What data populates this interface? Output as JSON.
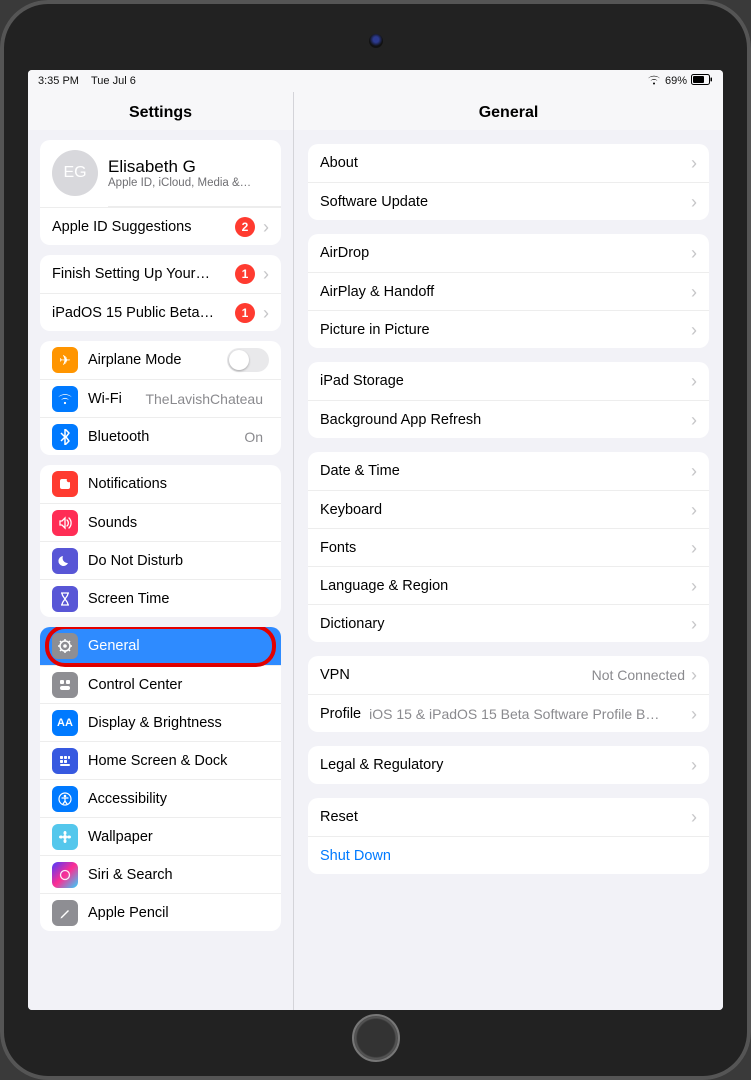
{
  "status": {
    "time": "3:35 PM",
    "date": "Tue Jul 6",
    "battery": "69%"
  },
  "sidebar": {
    "title": "Settings",
    "profile": {
      "initials": "EG",
      "name": "Elisabeth G",
      "subtitle": "Apple ID, iCloud, Media &…"
    },
    "appleIdSuggestions": {
      "label": "Apple ID Suggestions",
      "badge": "2"
    },
    "finishSetup": {
      "label": "Finish Setting Up Your…",
      "badge": "1"
    },
    "betaUpdate": {
      "label": "iPadOS 15 Public Beta…",
      "badge": "1"
    },
    "airplane": {
      "label": "Airplane Mode"
    },
    "wifi": {
      "label": "Wi-Fi",
      "value": "TheLavishChateau"
    },
    "bluetooth": {
      "label": "Bluetooth",
      "value": "On"
    },
    "notifications": {
      "label": "Notifications"
    },
    "sounds": {
      "label": "Sounds"
    },
    "dnd": {
      "label": "Do Not Disturb"
    },
    "screentime": {
      "label": "Screen Time"
    },
    "general": {
      "label": "General"
    },
    "controlCenter": {
      "label": "Control Center"
    },
    "display": {
      "label": "Display & Brightness"
    },
    "homescreen": {
      "label": "Home Screen & Dock"
    },
    "accessibility": {
      "label": "Accessibility"
    },
    "wallpaper": {
      "label": "Wallpaper"
    },
    "siri": {
      "label": "Siri & Search"
    },
    "pencil": {
      "label": "Apple Pencil"
    }
  },
  "detail": {
    "title": "General",
    "about": "About",
    "softwareUpdate": "Software Update",
    "airdrop": "AirDrop",
    "airplay": "AirPlay & Handoff",
    "pip": "Picture in Picture",
    "storage": "iPad Storage",
    "bgRefresh": "Background App Refresh",
    "datetime": "Date & Time",
    "keyboard": "Keyboard",
    "fonts": "Fonts",
    "langregion": "Language & Region",
    "dictionary": "Dictionary",
    "vpn": {
      "label": "VPN",
      "value": "Not Connected"
    },
    "profile": {
      "label": "Profile",
      "value": "iOS 15 & iPadOS 15 Beta Software Profile B…"
    },
    "legal": "Legal & Regulatory",
    "reset": "Reset",
    "shutdown": "Shut Down"
  },
  "colors": {
    "orange": "#ff9500",
    "blue": "#007aff",
    "red": "#ff3b30",
    "purple": "#5856d6",
    "gray": "#8e8e93",
    "teal": "#5ac8fa"
  }
}
